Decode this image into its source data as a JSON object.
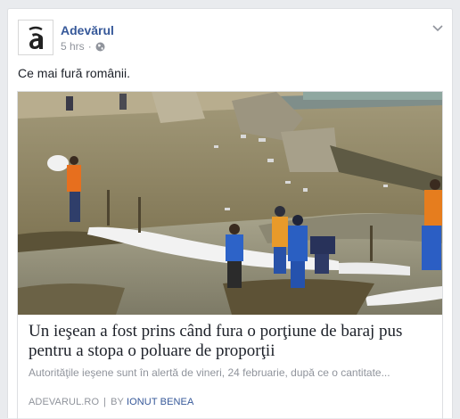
{
  "post": {
    "page_name": "Adevărul",
    "timestamp": "5 hrs",
    "separator": "·",
    "privacy_icon": "globe-icon",
    "menu_icon": "chevron-down-icon",
    "text": "Ce mai fură românii.",
    "avatar_icon": "adevarul-logo"
  },
  "link": {
    "title": "Un ieşean a fost prins când fura o porţiune de baraj pus pentru a stopa o poluare de proporţii",
    "description": "Autorităţile ieşene sunt în alertă de vineri, 24 februarie, după ce o cantitate...",
    "domain": "ADEVARUL.RO",
    "divider": "|",
    "by_label": "BY",
    "author": "IONUT BENEA"
  },
  "colors": {
    "link_blue": "#365899",
    "meta_grey": "#90949c",
    "text_dark": "#1d2129",
    "background": "#e9ebee"
  }
}
